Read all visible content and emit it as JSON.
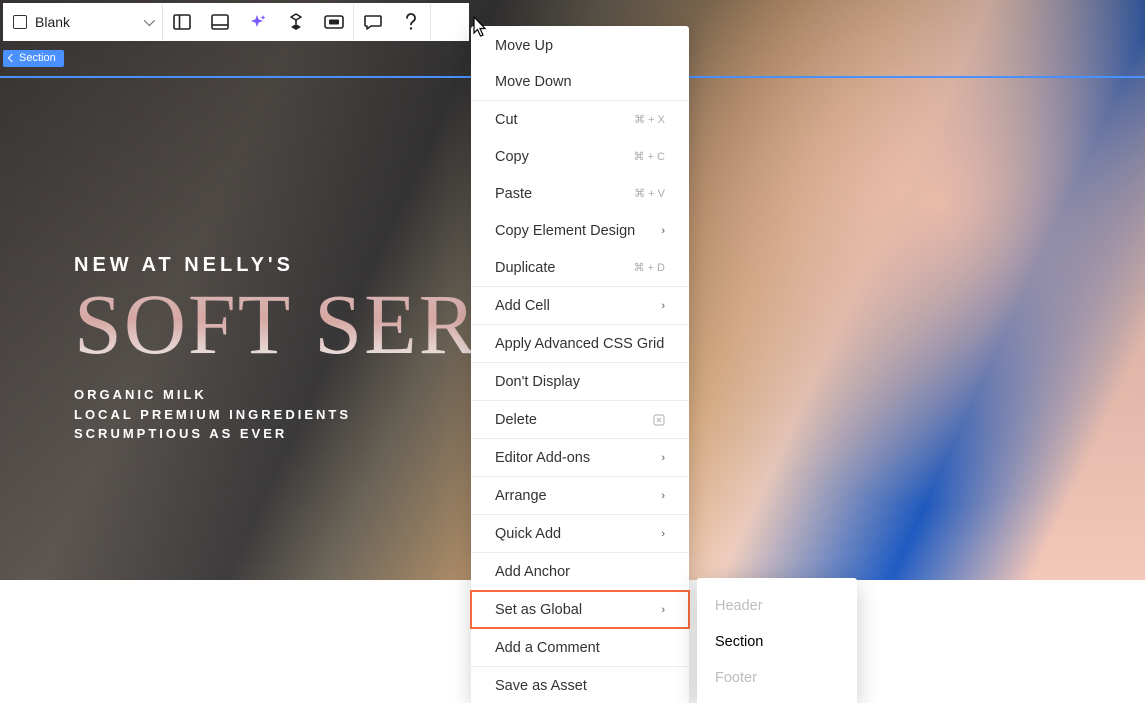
{
  "toolbar": {
    "template_label": "Blank"
  },
  "section_badge": "Section",
  "hero": {
    "kicker": "NEW AT NELLY'S",
    "title": "SOFT SERVE",
    "sub1": "ORGANIC MILK",
    "sub2": "LOCAL PREMIUM INGREDIENTS",
    "sub3": "SCRUMPTIOUS AS EVER"
  },
  "menu": {
    "move_up": "Move Up",
    "move_down": "Move Down",
    "cut": "Cut",
    "cut_sc": "⌘ + X",
    "copy": "Copy",
    "copy_sc": "⌘ + C",
    "paste": "Paste",
    "paste_sc": "⌘ + V",
    "copy_design": "Copy Element Design",
    "duplicate": "Duplicate",
    "duplicate_sc": "⌘ + D",
    "add_cell": "Add Cell",
    "apply_grid": "Apply Advanced CSS Grid",
    "dont_display": "Don't Display",
    "delete": "Delete",
    "editor_addons": "Editor Add-ons",
    "arrange": "Arrange",
    "quick_add": "Quick Add",
    "add_anchor": "Add Anchor",
    "set_global": "Set as Global",
    "add_comment": "Add a Comment",
    "save_asset": "Save as Asset"
  },
  "submenu": {
    "header": "Header",
    "section": "Section",
    "footer": "Footer"
  }
}
